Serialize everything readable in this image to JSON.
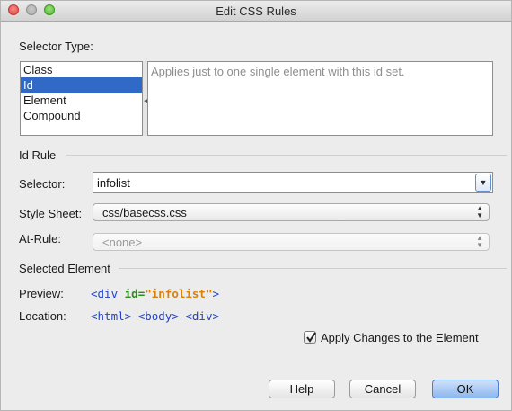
{
  "window": {
    "title": "Edit CSS Rules"
  },
  "selector_type": {
    "heading": "Selector Type:",
    "items": [
      "Class",
      "Id",
      "Element",
      "Compound"
    ],
    "selected": "Id",
    "description": "Applies just to one single element with this id set."
  },
  "id_rule": {
    "heading": "Id Rule",
    "selector_label": "Selector:",
    "selector_value": "infolist",
    "stylesheet_label": "Style Sheet:",
    "stylesheet_value": "css/basecss.css",
    "atrule_label": "At-Rule:",
    "atrule_value": "<none>"
  },
  "selected_element": {
    "heading": "Selected Element",
    "preview_label": "Preview:",
    "preview": {
      "open": "<div ",
      "attr": "id=",
      "value": "\"infolist\"",
      "close": ">"
    },
    "location_label": "Location:",
    "location": [
      "<html>",
      "<body>",
      "<div>"
    ]
  },
  "apply_changes": {
    "label": "Apply Changes to the Element",
    "checked": true
  },
  "buttons": {
    "help": "Help",
    "cancel": "Cancel",
    "ok": "OK"
  },
  "colors": {
    "accent": "#3169c6",
    "tag": "#2244cc",
    "attr": "#2e8b1e",
    "string": "#d8820c"
  }
}
